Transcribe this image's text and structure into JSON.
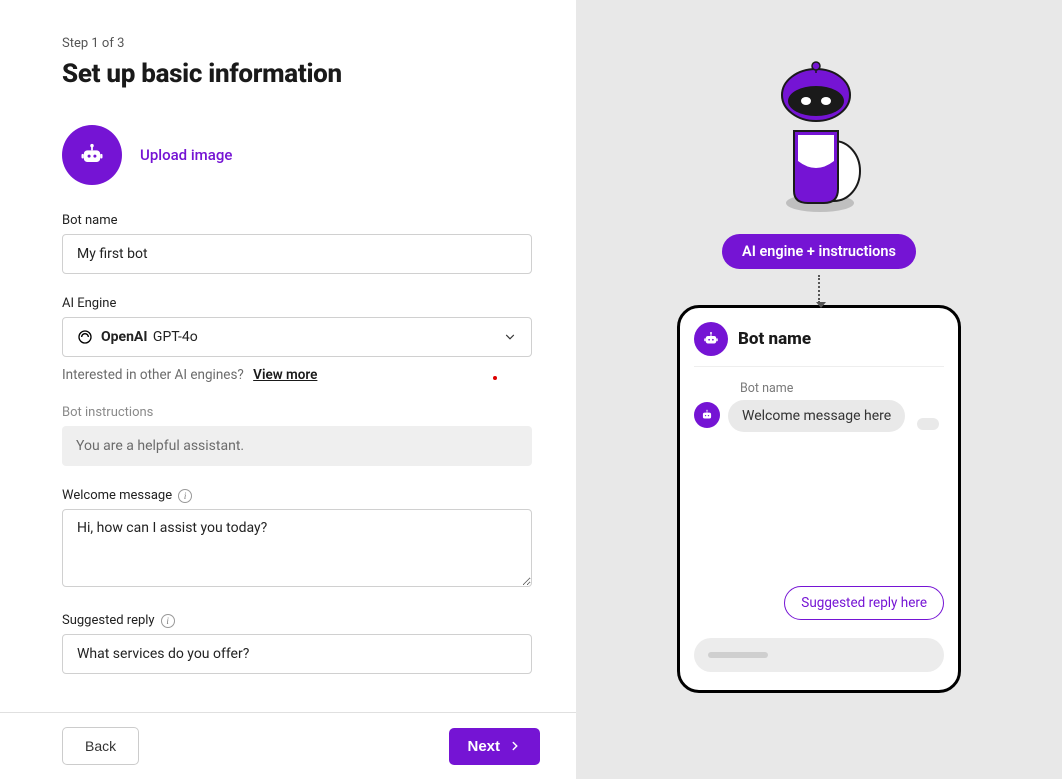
{
  "step": "Step 1 of 3",
  "title": "Set up basic information",
  "upload": {
    "link_label": "Upload image"
  },
  "fields": {
    "bot_name": {
      "label": "Bot name",
      "value": "My first bot"
    },
    "ai_engine": {
      "label": "AI Engine",
      "provider": "OpenAI",
      "model": "GPT-4o",
      "hint_prefix": "Interested in other AI engines?",
      "hint_link": "View more"
    },
    "instructions": {
      "label": "Bot instructions",
      "value": "You are a helpful assistant."
    },
    "welcome": {
      "label": "Welcome message",
      "value": "Hi, how can I assist you today?"
    },
    "suggested": {
      "label": "Suggested reply",
      "value": "What services do you offer?"
    }
  },
  "footer": {
    "back": "Back",
    "next": "Next"
  },
  "preview": {
    "pill": "AI engine + instructions",
    "header_title": "Bot name",
    "sender_label": "Bot name",
    "welcome_bubble": "Welcome message here",
    "suggested_chip": "Suggested reply here"
  },
  "colors": {
    "accent": "#7514d4"
  }
}
